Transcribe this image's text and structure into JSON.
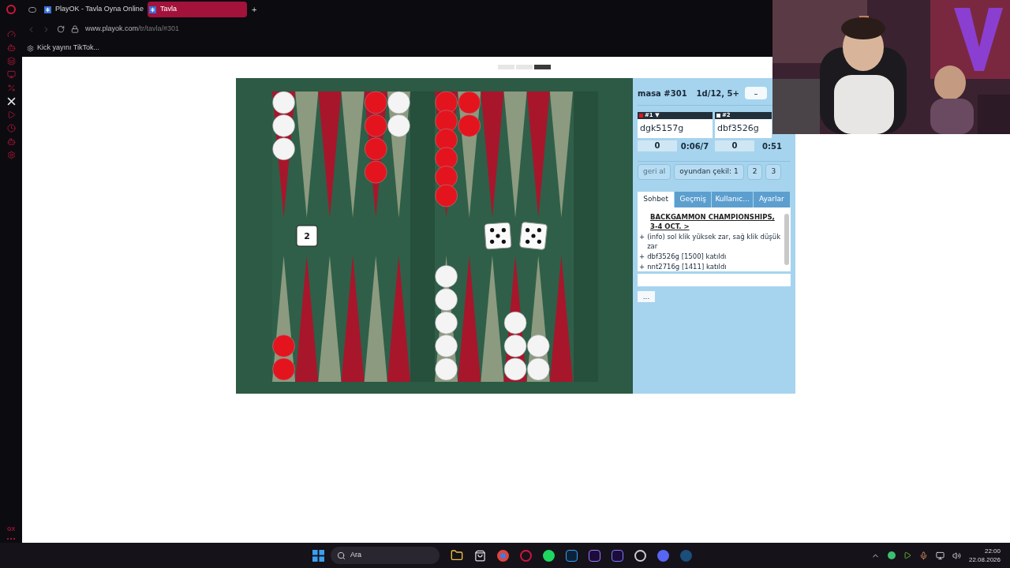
{
  "browser": {
    "tabs": [
      {
        "title": "PlayOK - Tavla Oyna Online",
        "selected": false
      },
      {
        "title": "Tavla",
        "selected": true
      }
    ],
    "new_tab": "+",
    "address": {
      "host": "www.playok.com",
      "path": "/tr/tavla/#301"
    },
    "bookmarks": [
      "Kick yayını TikTok..."
    ],
    "sidebar_footer": "GX"
  },
  "page_dots": [
    {
      "selected": false
    },
    {
      "selected": false
    },
    {
      "selected": true
    }
  ],
  "board": {
    "top_points": [
      {
        "kind": "stack",
        "checkers": [
          {
            "color": "#f4f4f4"
          },
          {
            "color": "#f4f4f4"
          },
          {
            "color": "#f4f4f4"
          }
        ]
      },
      {
        "kind": "empty"
      },
      {
        "kind": "empty"
      },
      {
        "kind": "empty"
      },
      {
        "kind": "stack",
        "checkers": [
          {
            "color": "#e4141e"
          },
          {
            "color": "#e4141e"
          },
          {
            "color": "#e4141e"
          },
          {
            "color": "#e4141e"
          }
        ]
      },
      {
        "kind": "stack",
        "checkers": [
          {
            "color": "#f4f4f4"
          },
          {
            "color": "#f4f4f4"
          }
        ]
      },
      {
        "kind": "stack",
        "checkers": [
          {
            "color": "#e4141e"
          },
          {
            "color": "#e4141e"
          },
          {
            "color": "#e4141e"
          },
          {
            "color": "#e4141e"
          },
          {
            "color": "#e4141e"
          },
          {
            "color": "#e4141e"
          }
        ]
      },
      {
        "kind": "stack",
        "checkers": [
          {
            "color": "#e4141e"
          },
          {
            "color": "#e4141e"
          }
        ]
      },
      {
        "kind": "empty"
      },
      {
        "kind": "empty"
      },
      {
        "kind": "empty"
      },
      {
        "kind": "empty"
      }
    ],
    "bottom_points": [
      {
        "kind": "stack",
        "checkers": [
          {
            "color": "#e4141e"
          },
          {
            "color": "#e4141e"
          }
        ]
      },
      {
        "kind": "empty"
      },
      {
        "kind": "empty"
      },
      {
        "kind": "empty"
      },
      {
        "kind": "empty"
      },
      {
        "kind": "empty"
      },
      {
        "kind": "stack",
        "checkers": [
          {
            "color": "#f4f4f4"
          },
          {
            "color": "#f4f4f4"
          },
          {
            "color": "#f4f4f4"
          },
          {
            "color": "#f4f4f4"
          },
          {
            "color": "#f4f4f4"
          }
        ]
      },
      {
        "kind": "empty"
      },
      {
        "kind": "empty"
      },
      {
        "kind": "stack",
        "checkers": [
          {
            "color": "#f4f4f4"
          },
          {
            "color": "#f4f4f4"
          },
          {
            "color": "#f4f4f4"
          }
        ]
      },
      {
        "kind": "stack",
        "checkers": [
          {
            "color": "#f4f4f4"
          },
          {
            "color": "#f4f4f4"
          }
        ]
      },
      {
        "kind": "empty"
      }
    ],
    "cube": "2",
    "dice": [
      {
        "kind": "five"
      },
      {
        "kind": "five"
      }
    ]
  },
  "panel": {
    "table": "masa #301",
    "settings": "1d/12, 5+",
    "minimize": "–",
    "players": [
      {
        "seat": "#1 ▼",
        "color": "#e4141e",
        "name": "dgk5157g",
        "score": "0",
        "clock": "0:06/7"
      },
      {
        "seat": "#2",
        "color": "#f4f4f4",
        "name": "dbf3526g",
        "score": "0",
        "clock": "0:51"
      }
    ],
    "buttons": [
      {
        "label": "geri al",
        "disabled": true
      },
      {
        "label": "oyundan çekil: 1",
        "disabled": false
      },
      {
        "label": "2",
        "disabled": false
      },
      {
        "label": "3",
        "disabled": false
      }
    ],
    "tabs": [
      {
        "label": "Sohbet",
        "selected": true
      },
      {
        "label": "Geçmiş",
        "selected": false
      },
      {
        "label": "Kullanıc...",
        "selected": false
      },
      {
        "label": "Ayarlar",
        "selected": false
      }
    ],
    "chat": [
      {
        "kind": "link",
        "text": "BACKGAMMON CHAMPIONSHIPS, 3-4 OCT. >"
      },
      {
        "kind": "line",
        "text": "(info) sol klik yüksek zar, sağ klik düşük zar"
      },
      {
        "kind": "line",
        "text": "dbf3526g [1500] katıldı"
      },
      {
        "kind": "line",
        "text": "nnt2716g [1411] katıldı"
      }
    ],
    "chat_bullet": "+",
    "more": "..."
  },
  "taskbar": {
    "search": "Ara",
    "time": "22:00",
    "date": "22.08.2026"
  }
}
